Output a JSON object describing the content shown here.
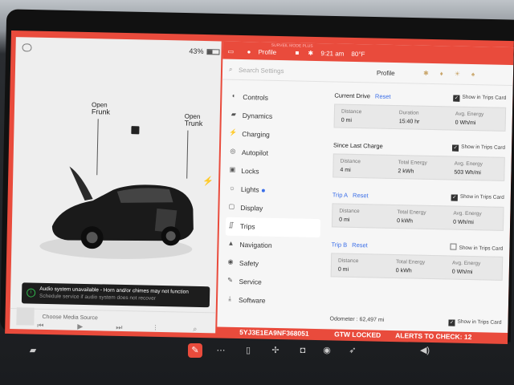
{
  "car": {
    "battery_pct": "43%",
    "frunk_state": "Open",
    "frunk_label": "Frunk",
    "trunk_state": "Open",
    "trunk_label": "Trunk",
    "alert_title": "Audio system unavailable - Horn and/or chimes may not function",
    "alert_sub": "Schedule service if audio system does not recover",
    "media_source": "Choose Media Source"
  },
  "topbar": {
    "sentry": "SURVEIL MODE PLUS",
    "profile": "Profile",
    "time": "9:21 am",
    "temp": "80°F"
  },
  "search": {
    "placeholder": "Search Settings",
    "profile": "Profile"
  },
  "nav": [
    {
      "label": "Controls",
      "icon": "toggle-icon"
    },
    {
      "label": "Dynamics",
      "icon": "car-icon"
    },
    {
      "label": "Charging",
      "icon": "bolt-icon"
    },
    {
      "label": "Autopilot",
      "icon": "steering-icon"
    },
    {
      "label": "Locks",
      "icon": "lock-icon"
    },
    {
      "label": "Lights",
      "icon": "bulb-icon"
    },
    {
      "label": "Display",
      "icon": "display-icon"
    },
    {
      "label": "Trips",
      "icon": "trips-icon"
    },
    {
      "label": "Navigation",
      "icon": "navigation-icon"
    },
    {
      "label": "Safety",
      "icon": "shield-icon"
    },
    {
      "label": "Service",
      "icon": "wrench-icon"
    },
    {
      "label": "Software",
      "icon": "download-icon"
    }
  ],
  "trips": {
    "current": {
      "title": "Current Drive",
      "reset": "Reset",
      "show": "Show in Trips Card",
      "c1_label": "Distance",
      "c1_val": "0 mi",
      "c2_label": "Duration",
      "c2_val": "15:40 hr",
      "c3_label": "Avg. Energy",
      "c3_val": "0 Wh/mi"
    },
    "since_charge": {
      "title": "Since Last Charge",
      "show": "Show in Trips Card",
      "c1_label": "Distance",
      "c1_val": "4 mi",
      "c2_label": "Total Energy",
      "c2_val": "2 kWh",
      "c3_label": "Avg. Energy",
      "c3_val": "503 Wh/mi"
    },
    "trip_a": {
      "title": "Trip A",
      "reset": "Reset",
      "show": "Show in Trips Card",
      "c1_label": "Distance",
      "c1_val": "0 mi",
      "c2_label": "Total Energy",
      "c2_val": "0 kWh",
      "c3_label": "Avg. Energy",
      "c3_val": "0 Wh/mi"
    },
    "trip_b": {
      "title": "Trip B",
      "reset": "Reset",
      "show": "Show in Trips Card",
      "c1_label": "Distance",
      "c1_val": "0 mi",
      "c2_label": "Total Energy",
      "c2_val": "0 kWh",
      "c3_label": "Avg. Energy",
      "c3_val": "0 Wh/mi"
    },
    "odometer": "Odometer : 62,497 mi",
    "odometer_show": "Show in Trips Card"
  },
  "bottom": {
    "vin": "5YJ3E1EA9NF368051",
    "locked": "GTW LOCKED",
    "alerts": "ALERTS TO CHECK: 12"
  }
}
